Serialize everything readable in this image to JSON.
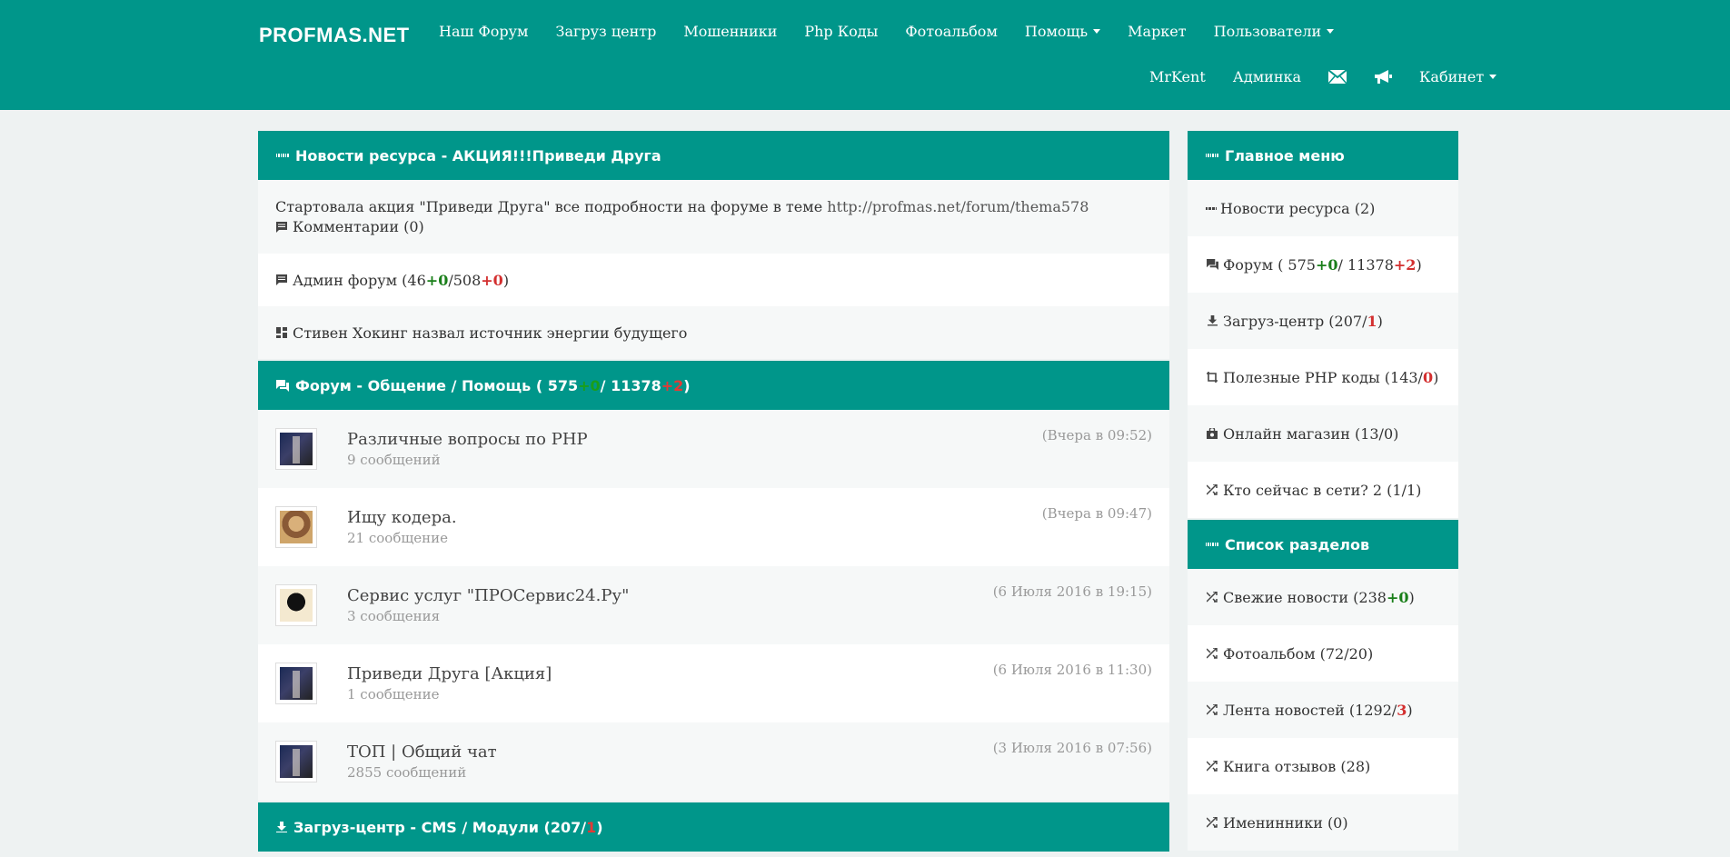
{
  "navbar": {
    "brand": "PROFMAS.NET",
    "row1": [
      {
        "label": "Наш Форум",
        "dropdown": false
      },
      {
        "label": "Загруз центр",
        "dropdown": false
      },
      {
        "label": "Мошенники",
        "dropdown": false
      },
      {
        "label": "Php Коды",
        "dropdown": false
      },
      {
        "label": "Фотоальбом",
        "dropdown": false
      },
      {
        "label": "Помощь",
        "dropdown": true
      },
      {
        "label": "Маркет",
        "dropdown": false
      },
      {
        "label": "Пользователи",
        "dropdown": true
      }
    ],
    "row2": {
      "user": "MrKent",
      "admin": "Админка",
      "mail_icon": "envelope-icon",
      "bullhorn_icon": "bullhorn-icon",
      "cabinet": "Кабинет"
    }
  },
  "news": {
    "title": "Новости ресурса - АКЦИЯ!!!Приведи Друга",
    "text": "Стартовала акция \"Приведи Друга\" все подробности на форуме в теме",
    "url": "http://profmas.net/forum/thema578",
    "comments": "Комментарии (0)",
    "admin_forum": {
      "prefix": "Админ форум (46 ",
      "v1": "+0",
      "mid": "/508 ",
      "v2": "+0",
      "suffix": ")"
    },
    "hawking": "Стивен Хокинг назвал источник энергии будущего"
  },
  "forum": {
    "title_prefix": "Форум - Общение / Помощь ( 575 ",
    "title_v1": "+0",
    "title_mid": " / 11378 ",
    "title_v2": "+2",
    "title_suffix": " )",
    "topics": [
      {
        "title": "Различные вопросы по PHP",
        "count": "9 сообщений",
        "date": "(Вчера в 09:52)",
        "avatar": "suit"
      },
      {
        "title": "Ищу кодера.",
        "count": "21 сообщение",
        "date": "(Вчера в 09:47)",
        "avatar": "person"
      },
      {
        "title": "Сервис услуг \"ПРОСервис24.Ру\"",
        "count": "3 сообщения",
        "date": "(6 Июля 2016 в 19:15)",
        "avatar": "bw"
      },
      {
        "title": "Приведи Друга [Акция]",
        "count": "1 сообщение",
        "date": "(6 Июля 2016 в 11:30)",
        "avatar": "suit"
      },
      {
        "title": "ТОП | Общий чат",
        "count": "2855 сообщений",
        "date": "(3 Июля 2016 в 07:56)",
        "avatar": "suit"
      }
    ]
  },
  "downloads": {
    "title_prefix": "Загруз-центр - CMS / Модули (207/",
    "title_v": "1",
    "title_suffix": ")"
  },
  "main_menu": {
    "title": "Главное меню",
    "items": {
      "news": "Новости ресурса (2)",
      "forum_prefix": "Форум ( 575 ",
      "forum_v1": "+0",
      "forum_mid": " / 11378 ",
      "forum_v2": "+2",
      "forum_suffix": " )",
      "downloads_prefix": "Загруз-центр (207/",
      "downloads_v": "1",
      "downloads_suffix": ")",
      "php_prefix": "Полезные PHP коды (143/",
      "php_v": "0",
      "php_suffix": ")",
      "shop": "Онлайн магазин (13/0)",
      "online": "Кто сейчас в сети? 2 (1/1)"
    }
  },
  "sections": {
    "title": "Список разделов",
    "items": {
      "fresh_prefix": "Свежие новости (238 ",
      "fresh_v": "+0",
      "fresh_suffix": ")",
      "photo": "Фотоальбом (72/20)",
      "feed_prefix": "Лента новостей (1292/",
      "feed_v": "3",
      "feed_suffix": ")",
      "guestbook": "Книга отзывов (28)",
      "birthdays": "Именинники (0)"
    }
  }
}
